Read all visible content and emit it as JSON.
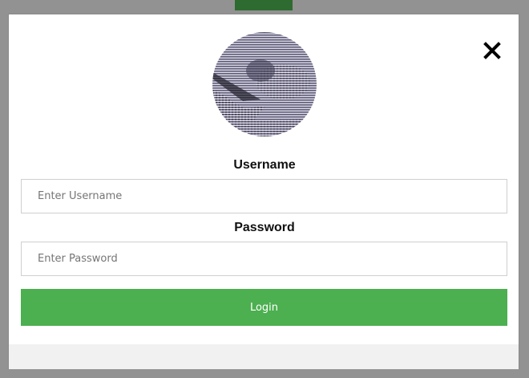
{
  "modal": {
    "close_icon": "close-icon",
    "avatar_icon": "user-avatar-image"
  },
  "form": {
    "username_label": "Username",
    "username_placeholder": "Enter Username",
    "username_value": "",
    "password_label": "Password",
    "password_placeholder": "Enter Password",
    "password_value": "",
    "login_label": "Login"
  },
  "colors": {
    "overlay": "#929292",
    "top_tab": "#2e6b30",
    "login_button": "#4caf50",
    "footer": "#f1f1f1"
  }
}
